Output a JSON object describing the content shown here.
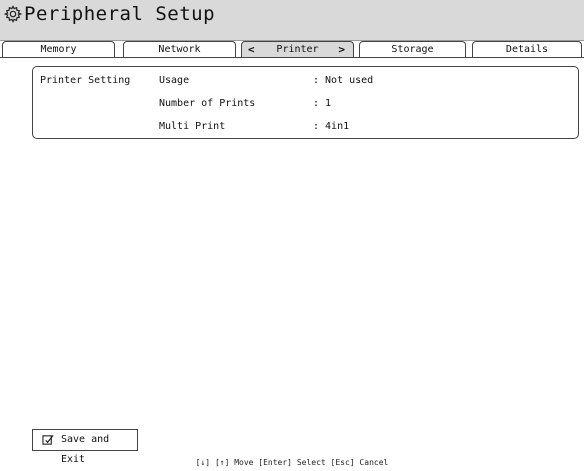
{
  "window": {
    "title": "Peripheral Setup",
    "icon": "gear-icon"
  },
  "tabs": [
    {
      "label": "Memory",
      "active": false
    },
    {
      "label": "Network",
      "active": false
    },
    {
      "label": "Printer",
      "active": true,
      "prev_arrow": "<",
      "next_arrow": ">"
    },
    {
      "label": "Storage",
      "active": false
    },
    {
      "label": "Details",
      "active": false
    }
  ],
  "printer_setting": {
    "section_label": "Printer Setting",
    "rows": [
      {
        "label": "Usage",
        "value": ": Not used"
      },
      {
        "label": "Number of Prints",
        "value": ": 1"
      },
      {
        "label": "Multi Print",
        "value": ": 4in1"
      }
    ]
  },
  "footer": {
    "save_label": "Save and Exit",
    "save_icon": "checkbox-edit-icon",
    "hint": "[↓] [↑] Move  [Enter] Select  [Esc] Cancel"
  },
  "colors": {
    "titlebar_bg": "#d9d9d9",
    "active_tab_bg": "#d9d9d9",
    "border": "#444444"
  }
}
